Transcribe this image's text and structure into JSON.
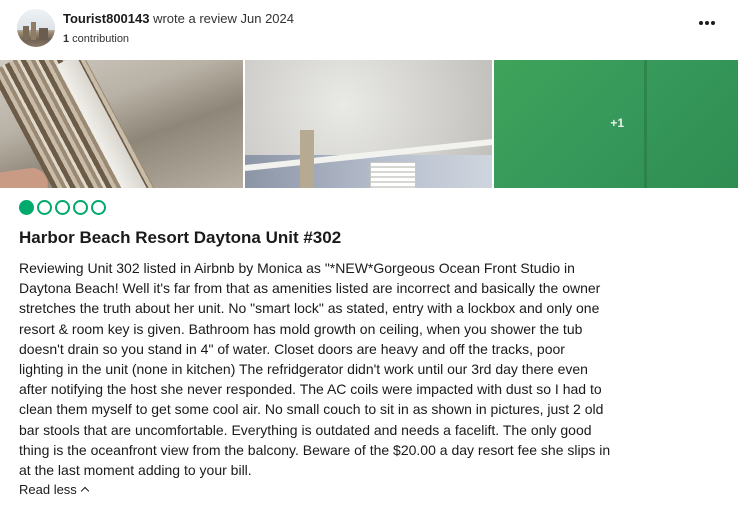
{
  "review": {
    "reviewer_name": "Tourist800143",
    "action_text": " wrote a review Jun 2024",
    "contributions_count": "1",
    "contributions_label": " contribution",
    "more_photos_label": "+1",
    "rating": {
      "value": 1,
      "max": 5,
      "color": "#00aa6c"
    },
    "title": "Harbor Beach Resort Daytona Unit #302",
    "body_lines": [
      "Reviewing Unit 302 listed in Airbnb by Monica as \"*NEW*Gorgeous Ocean Front Studio in",
      "Daytona Beach! Well it's far from that as amenities listed are incorrect and basically the owner",
      "stretches the truth about her unit. No \"smart lock\" as stated, entry with a lockbox and only one",
      "resort & room key is given. Bathroom has mold growth on ceiling, when you shower the tub",
      "doesn't drain so you stand in 4\" of water. Closet doors are heavy and off the tracks, poor",
      "lighting in the unit (none in kitchen) The refridgerator didn't work until our 3rd day there even",
      "after notifying the host she never responded. The AC coils were impacted with dust so I had to",
      "clean them myself to get some cool air. No small couch to sit in as shown in pictures, just 2 old",
      "bar stools that are uncomfortable. Everything is outdated and needs a facelift. The only good",
      "thing is the oceanfront view from the balcony. Beware of the $20.00 a day resort fee she slips in",
      "at the last moment adding to your bill."
    ],
    "read_less_label": "Read less"
  },
  "icons": {
    "more": "more-horizontal-icon",
    "read_less": "chevron-up-icon"
  }
}
